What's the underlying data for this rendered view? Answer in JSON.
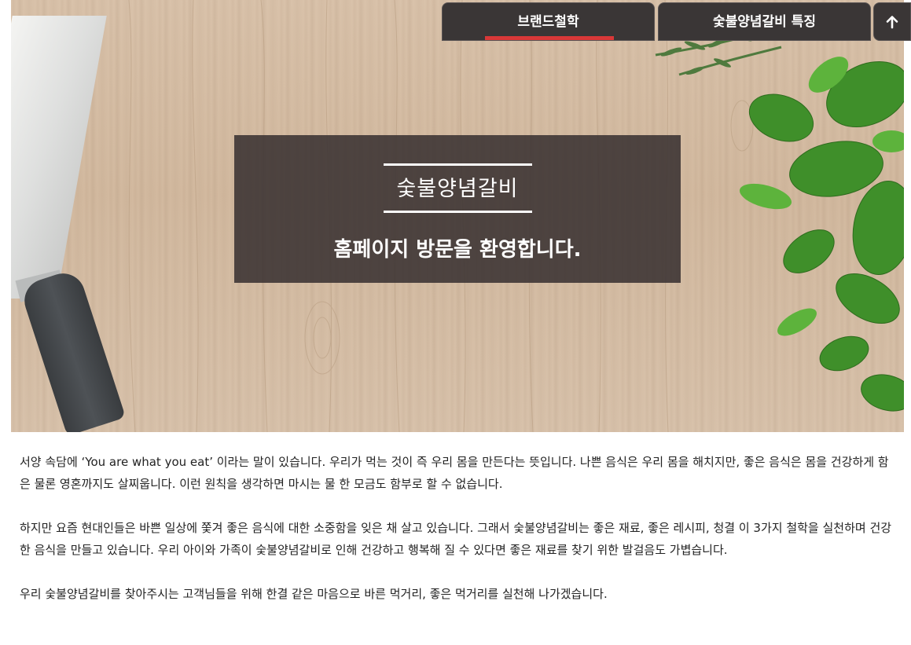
{
  "nav": {
    "tabs": [
      {
        "label": "브랜드철학",
        "active": true
      },
      {
        "label": "숯불양념갈비 특징",
        "active": false
      }
    ],
    "top_button_icon": "arrow-up-icon",
    "active_underline_color": "#d93838"
  },
  "hero": {
    "brand_title": "숯불양념갈비",
    "welcome_text": "홈페이지 방문을 환영합니다."
  },
  "content": {
    "paragraphs": [
      "서양 속담에 ‘You are what you eat’ 이라는 말이 있습니다. 우리가 먹는 것이 즉 우리 몸을 만든다는 뜻입니다. 나쁜 음식은 우리 몸을 해치지만, 좋은 음식은 몸을 건강하게 함은 물론 영혼까지도 살찌웁니다. 이런 원칙을 생각하면 마시는 물 한 모금도 함부로 할 수 없습니다.",
      "하지만 요즘 현대인들은 바쁜 일상에 쫓겨 좋은 음식에 대한 소중함을 잊은 채 살고 있습니다. 그래서 숯불양념갈비는 좋은 재료, 좋은 레시피, 청결 이 3가지 철학을 실천하며 건강한 음식을 만들고 있습니다. 우리 아이와 가족이 숯불양념갈비로 인해 건강하고 행복해 질 수 있다면 좋은 재료를 찾기 위한 발걸음도 가볍습니다.",
      "우리 숯불양념갈비를 찾아주시는 고객님들을 위해 한결 같은 마음으로 바른 먹거리, 좋은 먹거리를 실천해 나가겠습니다."
    ]
  }
}
